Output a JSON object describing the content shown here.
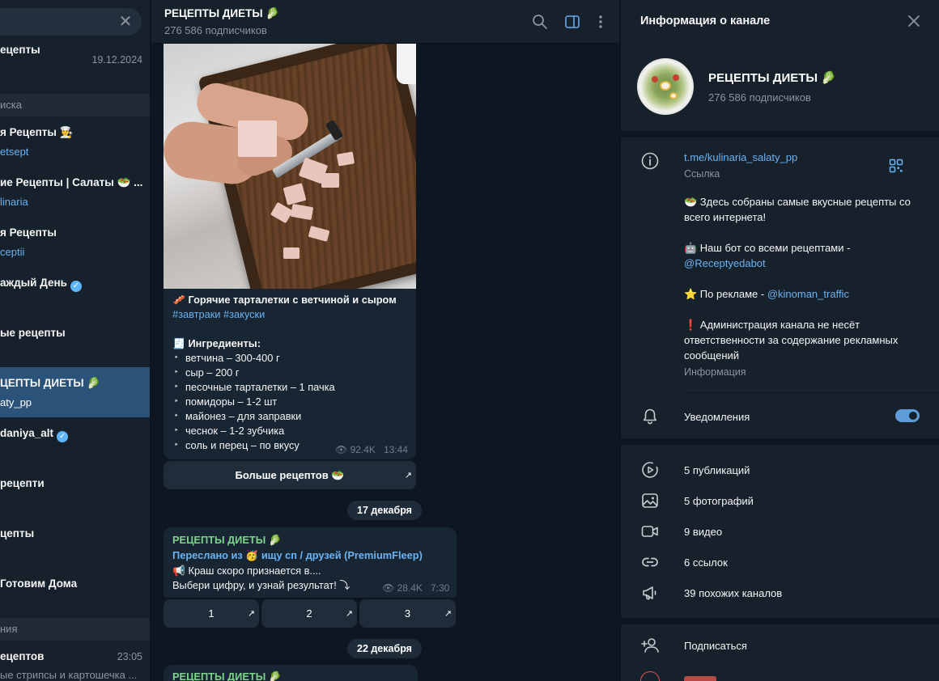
{
  "sidebar": {
    "items": [
      {
        "title": "ецепты",
        "subtitle": "",
        "date": "19.12.2024"
      },
      {
        "title": "я Рецепты 👨‍🍳",
        "subtitle": "etsept"
      },
      {
        "title": "ие Рецепты | Салаты 🥗 ...",
        "subtitle": "linaria"
      },
      {
        "title": "я Рецепты",
        "subtitle": "ceptii"
      },
      {
        "title": "аждый День",
        "subtitle": ""
      },
      {
        "title": "ые рецепты",
        "subtitle": ""
      },
      {
        "title": "ЦЕПТЫ ДИЕТЫ 🥬",
        "subtitle": "aty_pp"
      },
      {
        "title": "daniya_alt",
        "subtitle": ""
      },
      {
        "title": "рецепти",
        "subtitle": ""
      },
      {
        "title": "цепты",
        "subtitle": ""
      },
      {
        "title": "Готовим Дома",
        "subtitle": ""
      },
      {
        "title": "ецептов",
        "subtitle": "ые стрипсы и картошечка ...",
        "date": "23:05"
      }
    ],
    "section_search": "иска",
    "section_messages": "ния"
  },
  "chat": {
    "title": "РЕЦЕПТЫ ДИЕТЫ 🥬",
    "subscribers": "276 586 подписчиков",
    "post1": {
      "headline": "🥓 Горячие тарталетки с ветчиной и сыром",
      "tags": "#завтраки #закуски",
      "ingredients_title": "🧾 Ингредиенты:",
      "ingredients": [
        "ветчина – 300-400 г",
        "сыр – 200 г",
        "песочные тарталетки – 1 пачка",
        "помидоры – 1-2 шт",
        "майонез – для заправки",
        "чеснок – 1-2 зубчика",
        "соль и перец – по вкусу"
      ],
      "views": "92.4K",
      "time": "13:44",
      "button": "Больше рецептов 🥗"
    },
    "date1": "17 декабря",
    "post2": {
      "channel": "РЕЦЕПТЫ ДИЕТЫ 🥬",
      "forwarded": "Переслано из 🥳 ищу сп / друзей",
      "forwarded_user": "(PremiumFleep)",
      "line1": "📢 Краш скоро признается в....",
      "line2": "Выбери цифру, и узнай результат! ⤵",
      "views": "28.4K",
      "time": "7:30",
      "buttons": [
        "1",
        "2",
        "3"
      ]
    },
    "date2": "22 декабря",
    "post3": {
      "channel": "РЕЦЕПТЫ ДИЕТЫ 🥬"
    }
  },
  "info": {
    "panel_title": "Информация о канале",
    "name": "РЕЦЕПТЫ ДИЕТЫ 🥬",
    "subscribers": "276 586 подписчиков",
    "link": "t.me/kulinaria_salaty_pp",
    "link_label": "Ссылка",
    "description": {
      "p1": "🥗 Здесь собраны самые вкусные рецепты со всего интернета!",
      "p2_prefix": "🤖 Наш бот со всеми рецептами -",
      "p2_link": "@Receptyedabot",
      "p3_prefix": "⭐ По рекламе -",
      "p3_link": "@kinoman_traffic",
      "p4": "❗ Администрация канала не несёт ответственности за содержание рекламных сообщений"
    },
    "description_label": "Информация",
    "notifications": "Уведомления",
    "notifications_on": true,
    "media": [
      {
        "icon": "publications-icon",
        "label": "5 публикаций"
      },
      {
        "icon": "photos-icon",
        "label": "5 фотографий"
      },
      {
        "icon": "video-icon",
        "label": "9 видео"
      },
      {
        "icon": "links-icon",
        "label": "6 ссылок"
      },
      {
        "icon": "similar-channels-icon",
        "label": "39 похожих каналов"
      }
    ],
    "subscribe": "Подписаться"
  },
  "colors": {
    "accent": "#6ab3f3",
    "active_chat": "#2b5278",
    "background": "#0e1621",
    "panel": "#17212b"
  }
}
